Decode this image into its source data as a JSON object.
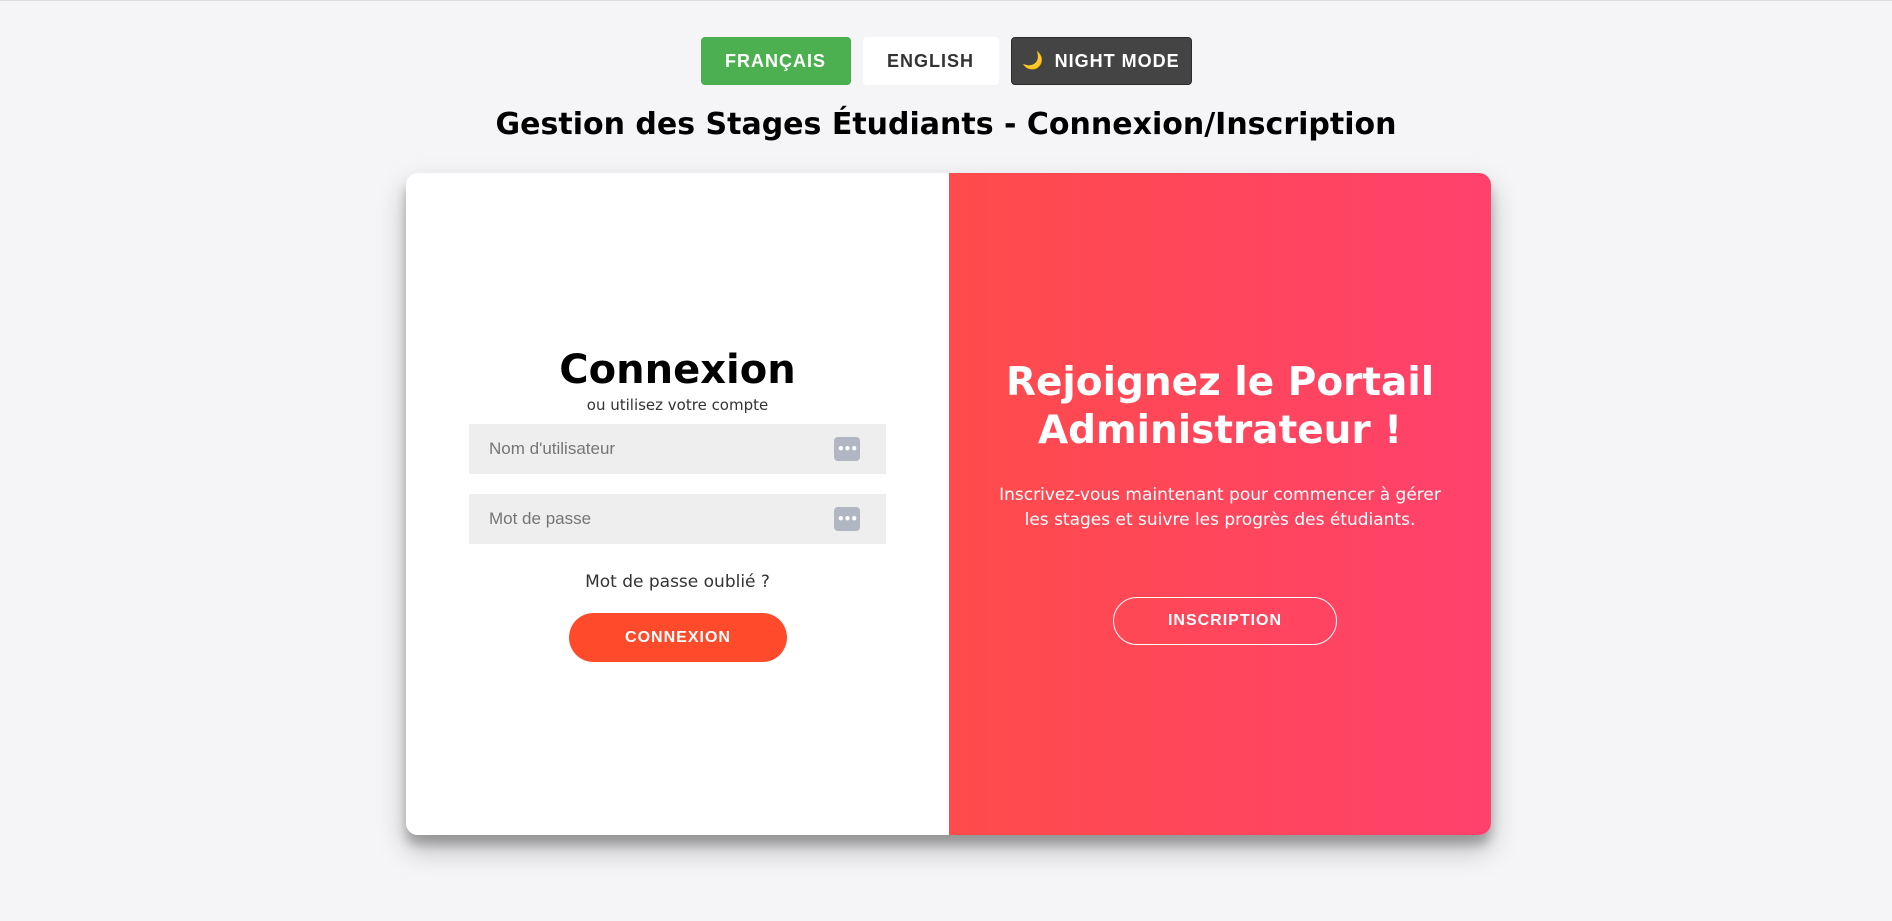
{
  "language_bar": {
    "french_label": "FRANÇAIS",
    "english_label": "ENGLISH",
    "night_mode_label": "NIGHT MODE",
    "night_mode_icon": "🌙",
    "active_language_color": "#4caf50"
  },
  "page": {
    "title": "Gestion des Stages Étudiants - Connexion/Inscription"
  },
  "login": {
    "title": "Connexion",
    "subtitle": "ou utilisez votre compte",
    "username_placeholder": "Nom d'utilisateur",
    "password_placeholder": "Mot de passe",
    "field_icon": "password-manager-icon",
    "field_icon_glyph": "•••",
    "forgot_label": "Mot de passe oublié ?",
    "submit_label": "CONNEXION",
    "submit_color": "#ff4b2b"
  },
  "promo": {
    "title": "Rejoignez le Portail Administrateur !",
    "text": "Inscrivez-vous maintenant pour commencer à gérer les stages et suivre les progrès des étudiants.",
    "signup_label": "INSCRIPTION",
    "gradient_start": "#ff4b4b",
    "gradient_end": "#ff416c"
  }
}
